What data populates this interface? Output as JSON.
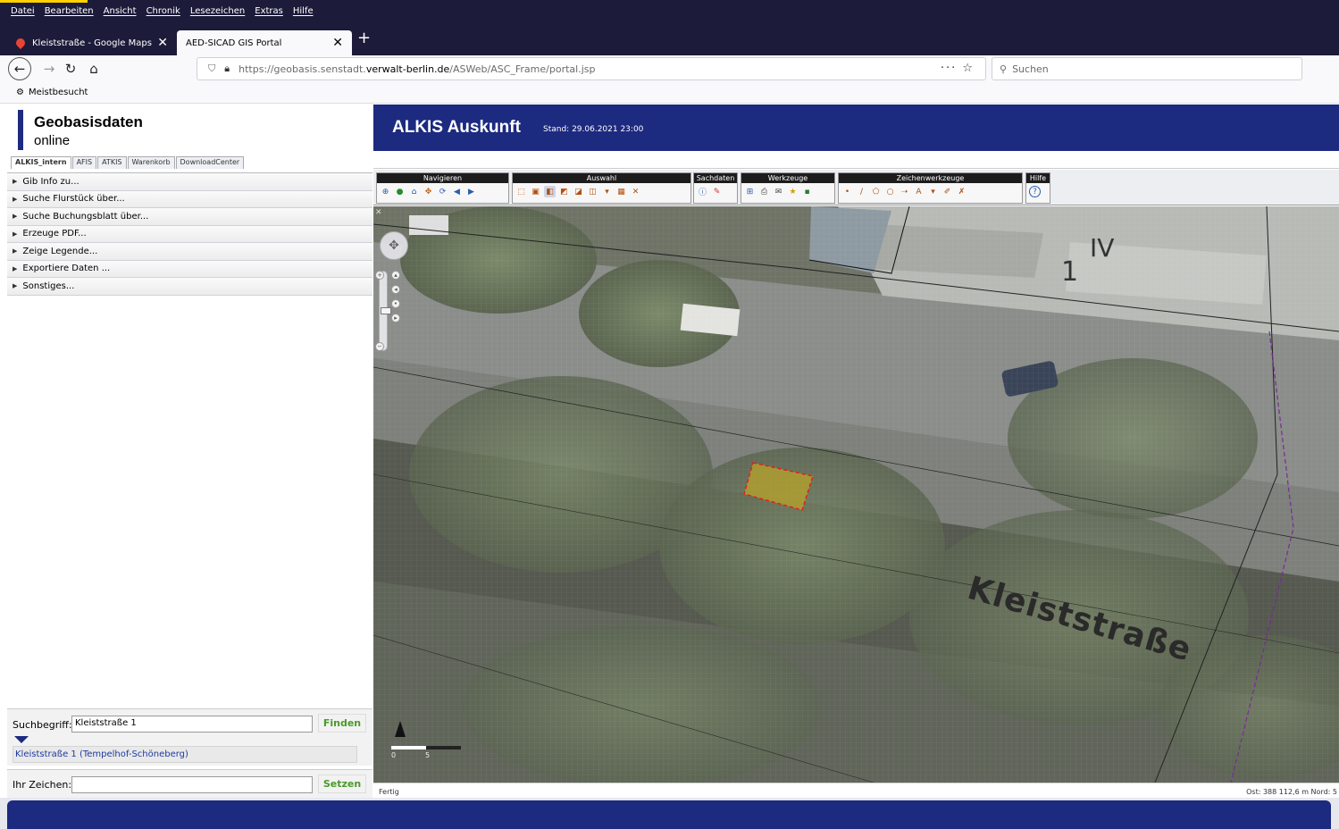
{
  "browser": {
    "menu": [
      "Datei",
      "Bearbeiten",
      "Ansicht",
      "Chronik",
      "Lesezeichen",
      "Extras",
      "Hilfe"
    ],
    "tabs": [
      {
        "title": "Kleiststraße - Google Maps"
      },
      {
        "title": "AED-SICAD GIS Portal"
      }
    ],
    "url_prefix": "https://geobasis.senstadt.",
    "url_domain": "verwalt-berlin.de",
    "url_path": "/ASWeb/ASC_Frame/portal.jsp",
    "search_placeholder": "Suchen",
    "bookmark": "Meistbesucht"
  },
  "left": {
    "logo_title": "Geobasisdaten",
    "logo_sub": "online",
    "tabs": [
      "ALKIS_intern",
      "AFIS",
      "ATKIS",
      "Warenkorb",
      "DownloadCenter"
    ],
    "accordion": [
      "Gib Info zu...",
      "Suche Flurstück über...",
      "Suche Buchungsblatt über...",
      "Erzeuge PDF...",
      "Zeige Legende...",
      "Exportiere Daten ...",
      "Sonstiges..."
    ],
    "search_label": "Suchbegriff:",
    "search_value": "Kleiststraße 1",
    "find_label": "Finden",
    "result": "Kleiststraße 1 (Tempelhof-Schöneberg)",
    "sign_label": "Ihr Zeichen:",
    "set_label": "Setzen"
  },
  "header": {
    "title": "ALKIS Auskunft",
    "stand": "Stand: 29.06.2021 23:00"
  },
  "toolbar": {
    "groups": [
      "Navigieren",
      "Auswahl",
      "Sachdaten",
      "Werkzeuge",
      "Zeichenwerkzeuge",
      "Hilfe"
    ]
  },
  "map": {
    "street_label": "Kleiststraße",
    "building_roman": "IV",
    "building_number": "1",
    "scale_0": "0",
    "scale_1": "5"
  },
  "status": {
    "left": "Fertig",
    "coords": "Ost: 388 112,6 m Nord: 5"
  }
}
